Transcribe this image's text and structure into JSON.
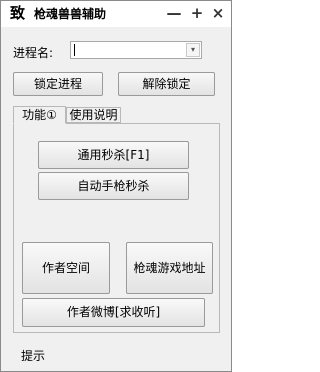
{
  "window": {
    "icon_glyph": "致",
    "title": "枪魂兽兽辅助",
    "minimize_label": "—",
    "pin_label": "+",
    "close_label": "×"
  },
  "process": {
    "label": "进程名:",
    "value": ""
  },
  "buttons": {
    "lock": "锁定进程",
    "unlock": "解除锁定"
  },
  "tabs": [
    "功能①",
    "使用说明"
  ],
  "functions": {
    "kill_all": "通用秒杀[F1]",
    "auto_sniper": "自动手枪秒杀",
    "author_space": "作者空间",
    "game_address": "枪魂游戏地址",
    "author_weibo": "作者微博[求收听]"
  },
  "status": {
    "hint": "提示"
  }
}
